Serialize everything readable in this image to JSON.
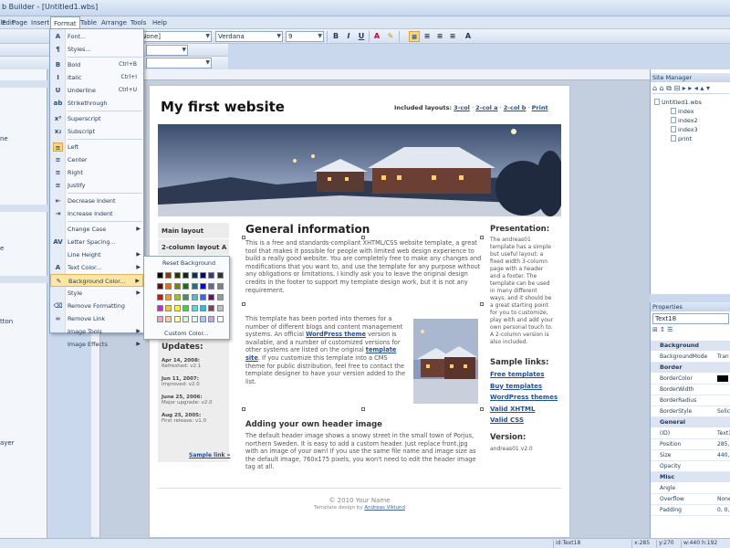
{
  "window": {
    "title": "b Builder - [Untitled1.wbs]"
  },
  "menubar": [
    "File",
    "Edit",
    "Page",
    "Insert",
    "Format",
    "Table",
    "Arrange",
    "Tools",
    "Help"
  ],
  "toolbar": {
    "style_combo": "None]",
    "font_combo": "Verdana",
    "size_combo": "9",
    "bold": "B",
    "italic": "I",
    "underline": "U"
  },
  "format_menu": [
    {
      "label": "Font...",
      "icon": "font-icon",
      "glyph": "A"
    },
    {
      "label": "Styles...",
      "icon": "styles-icon",
      "glyph": "¶"
    },
    {
      "sep": true
    },
    {
      "label": "Bold",
      "shortcut": "Ctrl+B",
      "icon": "bold-icon",
      "glyph": "B"
    },
    {
      "label": "Italic",
      "shortcut": "Ctrl+I",
      "icon": "italic-icon",
      "glyph": "I"
    },
    {
      "label": "Underline",
      "shortcut": "Ctrl+U",
      "icon": "underline-icon",
      "glyph": "U"
    },
    {
      "label": "Strikethrough",
      "icon": "strikethrough-icon",
      "glyph": "ab"
    },
    {
      "sep": true
    },
    {
      "label": "Superscript",
      "icon": "superscript-icon",
      "glyph": "x²"
    },
    {
      "label": "Subscript",
      "icon": "subscript-icon",
      "glyph": "x₂"
    },
    {
      "sep": true
    },
    {
      "label": "Left",
      "icon": "align-left-icon",
      "glyph": "≡",
      "active": true
    },
    {
      "label": "Center",
      "icon": "align-center-icon",
      "glyph": "≡"
    },
    {
      "label": "Right",
      "icon": "align-right-icon",
      "glyph": "≡"
    },
    {
      "label": "Justify",
      "icon": "justify-icon",
      "glyph": "≡"
    },
    {
      "sep": true
    },
    {
      "label": "Decrease Indent",
      "icon": "decrease-indent-icon",
      "glyph": "⇤"
    },
    {
      "label": "Increase Indent",
      "icon": "increase-indent-icon",
      "glyph": "⇥"
    },
    {
      "sep": true
    },
    {
      "label": "Change Case",
      "submenu": true,
      "icon": "",
      "glyph": ""
    },
    {
      "label": "Letter Spacing...",
      "icon": "letter-spacing-icon",
      "glyph": "AV"
    },
    {
      "label": "Line Height",
      "submenu": true,
      "icon": "",
      "glyph": ""
    },
    {
      "label": "Text Color...",
      "submenu": true,
      "icon": "text-color-icon",
      "glyph": "A"
    },
    {
      "label": "Background Color...",
      "submenu": true,
      "icon": "background-color-icon",
      "glyph": "✎",
      "highlight": true
    },
    {
      "label": "Style",
      "submenu": true,
      "icon": "",
      "glyph": ""
    },
    {
      "label": "Remove Formatting",
      "icon": "remove-formatting-icon",
      "glyph": "⌫"
    },
    {
      "label": "Remove Link",
      "icon": "remove-link-icon",
      "glyph": "∞"
    },
    {
      "label": "Image Tools",
      "submenu": true,
      "icon": "",
      "glyph": ""
    },
    {
      "label": "Image Effects",
      "submenu": true,
      "icon": "",
      "glyph": ""
    }
  ],
  "color_sub": {
    "reset": "Reset Background",
    "custom": "Custom Color...",
    "swatches": [
      "#000000",
      "#993300",
      "#333300",
      "#003300",
      "#003366",
      "#000080",
      "#333399",
      "#333333",
      "#800000",
      "#FF6600",
      "#808000",
      "#008000",
      "#008080",
      "#0000FF",
      "#666699",
      "#808080",
      "#FF0000",
      "#FF9900",
      "#99CC00",
      "#339966",
      "#33CCCC",
      "#3366FF",
      "#800080",
      "#969696",
      "#FF00FF",
      "#FFCC00",
      "#FFFF00",
      "#00FF00",
      "#00FFFF",
      "#00CCFF",
      "#993366",
      "#C0C0C0",
      "#FF99CC",
      "#FFCC99",
      "#FFFF99",
      "#CCFFCC",
      "#CCFFFF",
      "#99CCFF",
      "#CC99FF",
      "#FFFFFF"
    ]
  },
  "leftpanel_labels": [
    "ne",
    "e",
    "tton",
    "ayer"
  ],
  "page": {
    "title": "My first website",
    "layouts_label": "Included layouts:",
    "layout_links": [
      "3-col",
      "2-col a",
      "2-col b",
      "Print"
    ],
    "nav": [
      "Main layout",
      "2-column layout A"
    ],
    "updates_h": "Updates:",
    "updates": [
      {
        "d": "Apr 14, 2008:",
        "t": "Refreshed: v2.1"
      },
      {
        "d": "Jun 11, 2007:",
        "t": "Improved: v2.0"
      },
      {
        "d": "June 25, 2006:",
        "t": "Major upgrade: v2.0"
      },
      {
        "d": "Aug 25, 2005:",
        "t": "First release: v1.0"
      }
    ],
    "sample_link": "Sample link »",
    "general_h": "General information",
    "p1": "This is a free and standards-compliant XHTML/CSS website template, a great tool that makes it possible for people with limited web design experience to build a really good website. You are completely free to make any changes and modifications that you want to, and use the template for any purpose without any obligations or limitations. I kindly ask you to leave the original design credits in the footer to support my template design work, but it is not any requirement.",
    "p2a": "This template has been ported into themes for a number of different blogs and content management systems. An official ",
    "p2_wp": "WordPress theme",
    "p2b": " version is available, and a number of customized versions for other systems are listed on the original ",
    "p2_ts": "template site",
    "p2c": ". If you customize this template into a CMS theme for public distribution, feel free to contact the template designer to have your version added to the list.",
    "adding_h": "Adding your own header image",
    "p3": "The default header image shows a snowy street in the small town of Porjus, northern Sweden. It is easy to add a custom header. Just replace front.jpg with an image of your own! If you use the same file name and image size as the default image, 760x175 pixels, you won't need to edit the header image tag at all.",
    "presentation_h": "Presentation:",
    "presentation": "The andreas01 template has a simple but useful layout: a fixed width 3-column page with a header and a footer. The template can be used in many different ways, and it should be a great starting point for you to customize, play with and add your own personal touch to. A 2-column version is also included.",
    "sample_links_h": "Sample links:",
    "sample_links": [
      "Free templates",
      "Buy templates",
      "WordPress themes",
      "Valid XHTML",
      "Valid CSS"
    ],
    "version_h": "Version:",
    "version": "andreas01 v2.0",
    "footer1": "© 2010 Your Name",
    "footer2_pre": "Template design by ",
    "footer2_link": "Andreas Viklund"
  },
  "site_manager": {
    "title": "Site Manager",
    "root": "Untitled1.wbs",
    "pages": [
      "index",
      "index2",
      "index3",
      "print"
    ]
  },
  "properties": {
    "title": "Properties",
    "object": "Text18",
    "rows": [
      {
        "cat": "Background"
      },
      {
        "k": "BackgroundMode",
        "v": "Tran"
      },
      {
        "cat": "Border"
      },
      {
        "k": "BorderColor",
        "v": "",
        "swatch": "#000000"
      },
      {
        "k": "BorderWidth",
        "v": ""
      },
      {
        "k": "BorderRadius",
        "v": ""
      },
      {
        "k": "BorderStyle",
        "v": "Solic"
      },
      {
        "cat": "General"
      },
      {
        "k": "(ID)",
        "v": "Text18"
      },
      {
        "k": "Position",
        "v": "285,"
      },
      {
        "k": "Size",
        "v": "440,"
      },
      {
        "k": "Opacity",
        "v": ""
      },
      {
        "cat": "Misc"
      },
      {
        "k": "Angle",
        "v": ""
      },
      {
        "k": "Overflow",
        "v": "None"
      },
      {
        "k": "Padding",
        "v": "0, 0,"
      }
    ]
  },
  "status": [
    "id:Text18",
    "x:285",
    "y:270",
    "w:440 h:192"
  ]
}
